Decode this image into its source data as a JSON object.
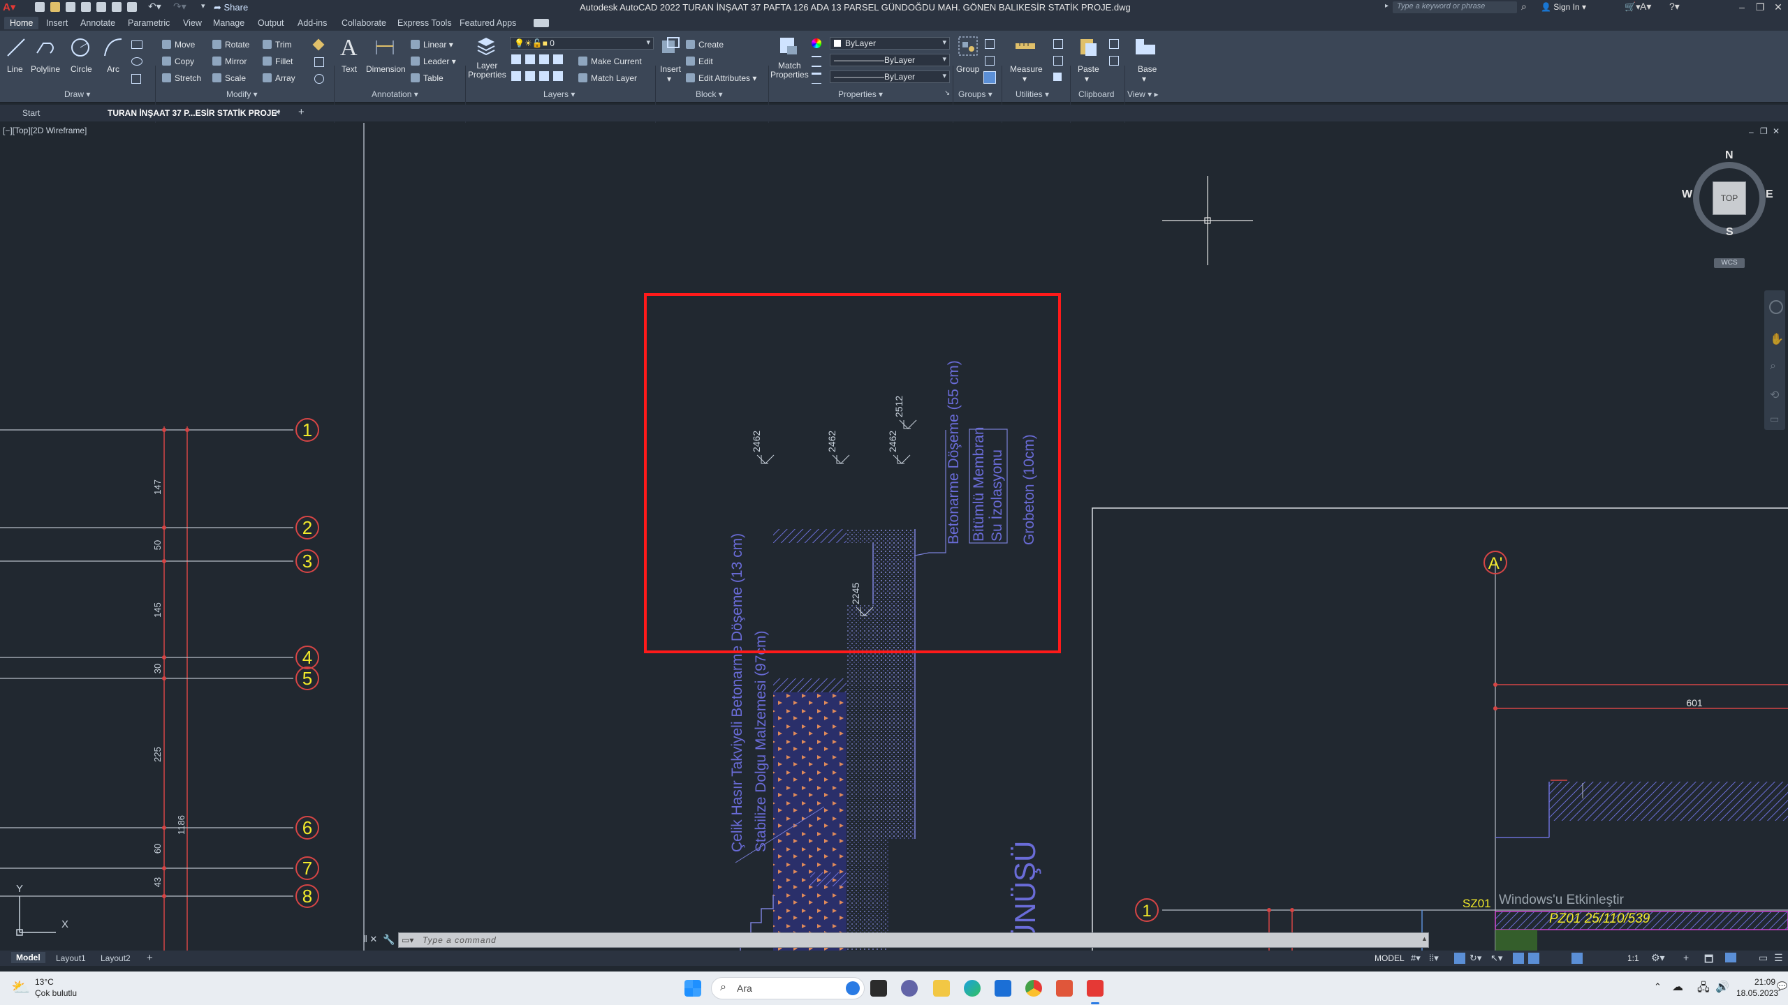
{
  "titlebar": {
    "app_title": "Autodesk AutoCAD 2022    TURAN İNŞAAT 37 PAFTA 126 ADA 13 PARSEL GÜNDOĞDU MAH. GÖNEN BALIKESİR STATİK PROJE.dwg",
    "share": "Share",
    "search_placeholder": "Type a keyword or phrase",
    "sign_in": "Sign In"
  },
  "ribbon_tabs": [
    "Home",
    "Insert",
    "Annotate",
    "Parametric",
    "View",
    "Manage",
    "Output",
    "Add-ins",
    "Collaborate",
    "Express Tools",
    "Featured Apps"
  ],
  "ribbon": {
    "draw": {
      "line": "Line",
      "polyline": "Polyline",
      "circle": "Circle",
      "arc": "Arc",
      "title": "Draw"
    },
    "modify": {
      "move": "Move",
      "rotate": "Rotate",
      "trim": "Trim",
      "copy": "Copy",
      "mirror": "Mirror",
      "fillet": "Fillet",
      "stretch": "Stretch",
      "scale": "Scale",
      "array": "Array",
      "title": "Modify"
    },
    "annotation": {
      "text": "Text",
      "dimension": "Dimension",
      "linear": "Linear",
      "leader": "Leader",
      "table": "Table",
      "title": "Annotation"
    },
    "layers": {
      "layer_properties": "Layer\nProperties",
      "current_layer": "0",
      "make_current": "Make Current",
      "match_layer": "Match Layer",
      "title": "Layers"
    },
    "block": {
      "insert": "Insert",
      "create": "Create",
      "edit": "Edit",
      "edit_attributes": "Edit Attributes",
      "title": "Block"
    },
    "properties": {
      "match_properties": "Match\nProperties",
      "color": "ByLayer",
      "linetype": "ByLayer",
      "lineweight": "ByLayer",
      "title": "Properties"
    },
    "groups": {
      "group": "Group",
      "title": "Groups"
    },
    "utilities": {
      "measure": "Measure",
      "title": "Utilities"
    },
    "clipboard": {
      "paste": "Paste",
      "title": "Clipboard"
    },
    "view": {
      "base": "Base",
      "title": "View"
    }
  },
  "doc_tabs": {
    "start": "Start",
    "active": "TURAN İNŞAAT 37 P...ESİR STATİK PROJE*"
  },
  "viewport_label": "[−][Top][2D Wireframe]",
  "viewcube": {
    "n": "N",
    "s": "S",
    "e": "E",
    "w": "W",
    "top": "TOP",
    "wcs": "WCS"
  },
  "drawing": {
    "axes_left": [
      "1",
      "2",
      "3",
      "4",
      "5",
      "6",
      "7",
      "8"
    ],
    "dims_left": [
      "147",
      "50",
      "145",
      "30",
      "225",
      "60",
      "43",
      "1186"
    ],
    "annotations_vertical": {
      "beton": "Betonarme Döşeme (55 cm)",
      "bitumlu": "Bitümlü Membran",
      "su": "Su İzolasyonu",
      "grobeton": "Grobeton (10cm)",
      "celik": "Çelik Hasır Takviyeli Betonarme Döşeme (13 cm)",
      "stabilize": "Stabilize Dolgu Malzemesi (97cm)",
      "gorunusu": "ÜNÜŞÜ"
    },
    "levels": [
      "2462",
      "2462",
      "2462",
      "2512",
      "2245"
    ],
    "right": {
      "axis_a": "A'",
      "axis_1": "1",
      "dim": "601",
      "sz": "SZ01",
      "pz": "PZ01 25/110/539"
    }
  },
  "command_placeholder": "Type a command",
  "layout_tabs": [
    "Model",
    "Layout1",
    "Layout2"
  ],
  "status": {
    "model": "MODEL",
    "scale": "1:1"
  },
  "activate_watermark": "Windows'u Etkinleştir",
  "taskbar": {
    "temperature": "13°C",
    "weather": "Çok bulutlu",
    "search": "Ara",
    "time": "21:09",
    "date": "18.05.2023"
  }
}
